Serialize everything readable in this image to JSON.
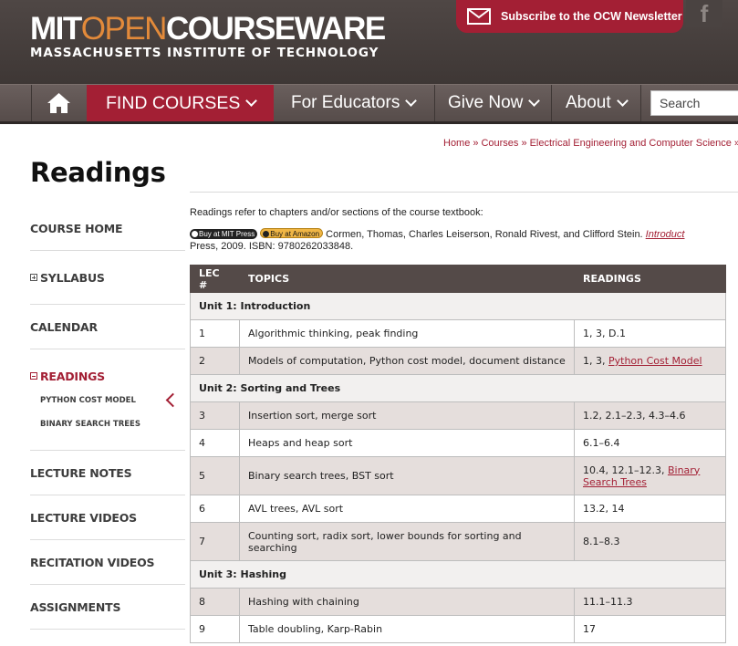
{
  "header": {
    "logo_mit": "MIT",
    "logo_open": "OPEN",
    "logo_cw": "COURSEWARE",
    "logo_sub": "MASSACHUSETTS INSTITUTE OF TECHNOLOGY",
    "newsletter_label": "Subscribe to the OCW Newsletter",
    "facebook_glyph": "f"
  },
  "nav": {
    "find_courses": "FIND COURSES",
    "for_educators": "For Educators",
    "give_now": "Give Now",
    "about": "About",
    "search_placeholder": "Search"
  },
  "breadcrumb": {
    "home": "Home",
    "courses": "Courses",
    "department": "Electrical Engineering and Computer Science",
    "separator": "»"
  },
  "page": {
    "title": "Readings"
  },
  "sidebar": {
    "items": [
      {
        "label": "COURSE HOME"
      },
      {
        "label": "SYLLABUS"
      },
      {
        "label": "CALENDAR"
      },
      {
        "label": "READINGS"
      },
      {
        "label": "LECTURE NOTES"
      },
      {
        "label": "LECTURE VIDEOS"
      },
      {
        "label": "RECITATION VIDEOS"
      },
      {
        "label": "ASSIGNMENTS"
      }
    ],
    "sub_items": [
      {
        "label": "PYTHON COST MODEL"
      },
      {
        "label": "BINARY SEARCH TREES"
      }
    ]
  },
  "content": {
    "intro": "Readings refer to chapters and/or sections of the course textbook:",
    "badge_mit": "Buy at MIT Press",
    "badge_amazon": "Buy at Amazon",
    "authors": " Cormen, Thomas, Charles Leiserson, Ronald Rivest, and Clifford Stein. ",
    "book_title": "Introduct",
    "publisher": "Press, 2009. ISBN: 9780262033848."
  },
  "table": {
    "headers": [
      "LEC #",
      "TOPICS",
      "READINGS"
    ],
    "units": [
      "Unit 1: Introduction",
      "Unit 2: Sorting and Trees",
      "Unit 3: Hashing"
    ],
    "rows": [
      {
        "lec": "1",
        "topic": "Algorithmic thinking, peak finding",
        "reading": "1, 3, D.1",
        "link": ""
      },
      {
        "lec": "2",
        "topic": "Models of computation, Python cost model, document distance",
        "reading": "1, 3, ",
        "link": "Python Cost Model"
      },
      {
        "lec": "3",
        "topic": "Insertion sort, merge sort",
        "reading": "1.2, 2.1–2.3, 4.3–4.6",
        "link": ""
      },
      {
        "lec": "4",
        "topic": "Heaps and heap sort",
        "reading": "6.1–6.4",
        "link": ""
      },
      {
        "lec": "5",
        "topic": "Binary search trees, BST sort",
        "reading": "10.4, 12.1–12.3, ",
        "link": "Binary Search Trees"
      },
      {
        "lec": "6",
        "topic": "AVL trees, AVL sort",
        "reading": "13.2, 14",
        "link": ""
      },
      {
        "lec": "7",
        "topic": "Counting sort, radix sort, lower bounds for sorting and searching",
        "reading": "8.1–8.3",
        "link": ""
      },
      {
        "lec": "8",
        "topic": "Hashing with chaining",
        "reading": "11.1–11.3",
        "link": ""
      },
      {
        "lec": "9",
        "topic": "Table doubling, Karp-Rabin",
        "reading": "17",
        "link": ""
      }
    ]
  },
  "colors": {
    "brand_red": "#a31f34",
    "header_brown": "#4f4745",
    "open_orange": "#e38a3a",
    "table_header": "#544a48",
    "row_shade": "#e5dedc"
  },
  "icons": {
    "home": "home-icon",
    "envelope": "envelope-icon",
    "facebook": "facebook-icon",
    "collapse_arrow": "chevron-left-icon"
  }
}
